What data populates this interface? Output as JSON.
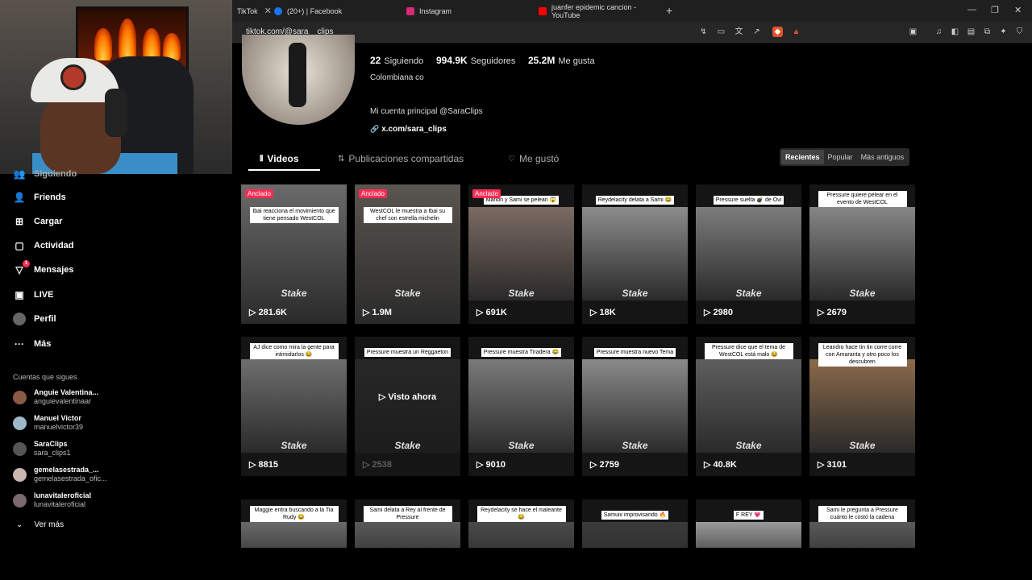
{
  "browser": {
    "tabs": [
      {
        "label": "TikTok",
        "color": "#111111"
      },
      {
        "label": "(20+) | Facebook",
        "color": "#1877f2"
      },
      {
        "label": "Instagram",
        "color": "#d62976"
      },
      {
        "label": "juanfer epidemic cancion - YouTube",
        "color": "#ff0000"
      }
    ],
    "url": "tiktok.com/@sara__clips"
  },
  "sidebar": {
    "items": [
      {
        "label": "Siguiendo",
        "icon": "following-icon"
      },
      {
        "label": "Friends",
        "icon": "friends-icon"
      },
      {
        "label": "Cargar",
        "icon": "upload-icon"
      },
      {
        "label": "Actividad",
        "icon": "activity-icon"
      },
      {
        "label": "Mensajes",
        "icon": "messages-icon",
        "badge": "1"
      },
      {
        "label": "LIVE",
        "icon": "live-icon"
      },
      {
        "label": "Perfil",
        "icon": "profile-icon"
      },
      {
        "label": "Más",
        "icon": "more-icon"
      }
    ],
    "following_title": "Cuentas que sigues",
    "following": [
      {
        "name": "Anguie Valentina...",
        "handle": "anguievalentinaar",
        "color": "#8a5a44"
      },
      {
        "name": "Manuel Victor",
        "handle": "manuelvictor39",
        "color": "#9fb8c8"
      },
      {
        "name": "SaraClips",
        "handle": "sara_clips1",
        "color": "#555555"
      },
      {
        "name": "gemelasestrada_...",
        "handle": "gemelasestrada_ofic...",
        "color": "#c9b8b0"
      },
      {
        "name": "lunavitaleroficial",
        "handle": "lunavitaleroficial",
        "color": "#7a6a70"
      }
    ],
    "see_more": "Ver más"
  },
  "profile": {
    "following_count": "22",
    "following_label": "Siguiendo",
    "followers_count": "994.9K",
    "followers_label": "Seguidores",
    "likes_count": "25.2M",
    "likes_label": "Me gusta",
    "bio_line1": "Colombiana co",
    "bio_line2": "Mi cuenta principal @SaraClips",
    "link": "x.com/sara_clips",
    "tabs": [
      "Videos",
      "Publicaciones compartidas",
      "Me gustó"
    ],
    "sort": [
      "Recientes",
      "Popular",
      "Más antiguos"
    ]
  },
  "videos": [
    {
      "caption": "Ibai reacciona el movimiento que tiene pensado WestCOL",
      "views": "281.6K",
      "pinned": true,
      "color": "#6a6a6a"
    },
    {
      "caption": "WestCOL le muestra a Ibai su chef con estrella michelin",
      "views": "1.9M",
      "pinned": true,
      "color": "#5a5650"
    },
    {
      "caption": "Marlon y Sami se pelean 😱",
      "views": "691K",
      "pinned": true,
      "color": "#7a6a62"
    },
    {
      "caption": "Reydelacity delata a Sami 😂",
      "views": "18K",
      "pinned": false,
      "color": "#8c8c8c"
    },
    {
      "caption": "Pressure suelta 💣 de Ovi",
      "views": "2980",
      "pinned": false,
      "color": "#7c7c7c"
    },
    {
      "caption": "Pressure quiere pelear en el evento de WestCOL",
      "views": "2679",
      "pinned": false,
      "color": "#868686"
    },
    {
      "caption": "AJ dice como mira la gente para intimidarlos 😂",
      "views": "8815",
      "pinned": false,
      "color": "#6e6e6e"
    },
    {
      "caption": "Pressure muestra un Reggaeton",
      "views": "2538",
      "pinned": false,
      "watched": "Visto ahora",
      "color": "#4a4a4a"
    },
    {
      "caption": "Pressure muestra Tiradera 😂",
      "views": "9010",
      "pinned": false,
      "color": "#7a7a7a"
    },
    {
      "caption": "Pressure muestra nuevo Tema",
      "views": "2759",
      "pinned": false,
      "color": "#8a8a8a"
    },
    {
      "caption": "Pressure dice que el tema de WestCOL está malo 😂",
      "views": "40.8K",
      "pinned": false,
      "color": "#5e5e5e"
    },
    {
      "caption": "Leandro hace tin tin corre corre con Amaranta y otro poco los descubren",
      "views": "3101",
      "pinned": false,
      "color": "#8a6a4a"
    },
    {
      "caption": "Maggie entra buscando a la Tia Rudy 😂",
      "views": "",
      "pinned": false,
      "color": "#6a6a6a"
    },
    {
      "caption": "Sami delata a Rey al frente de Pressure",
      "views": "",
      "pinned": false,
      "color": "#5a5a5a"
    },
    {
      "caption": "Reydelacity se hace el maleante 😂",
      "views": "",
      "pinned": false,
      "color": "#4a4a4a"
    },
    {
      "caption": "Samuix improvisando 🔥",
      "views": "",
      "pinned": false,
      "color": "#3a3a3a"
    },
    {
      "caption": "F REY 💗",
      "views": "",
      "pinned": false,
      "color": "#9a9a9a"
    },
    {
      "caption": "Sami le pregunta a Pressure cuánto le costó la cadena",
      "views": "",
      "pinned": false,
      "color": "#5a5a5a"
    }
  ],
  "pinned_label": "Anclado",
  "watermark": "Stake"
}
